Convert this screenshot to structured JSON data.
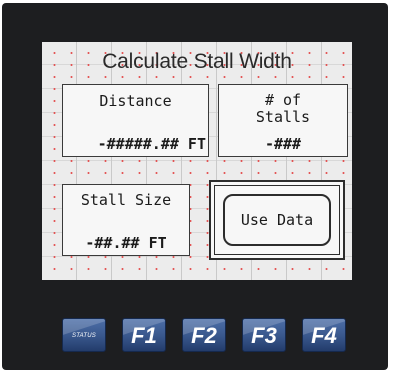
{
  "screen": {
    "title": "Calculate Stall Width",
    "distance": {
      "label": "Distance",
      "value": "-#####.## FT"
    },
    "stalls": {
      "label_line1": "# of",
      "label_line2": "Stalls",
      "value": "-###"
    },
    "stall_size": {
      "label": "Stall Size",
      "value": "-##.## FT"
    },
    "use_data_button": "Use Data"
  },
  "function_keys": [
    {
      "label": "STATUS",
      "icon": "status-key"
    },
    {
      "label": "F1"
    },
    {
      "label": "F2"
    },
    {
      "label": "F3"
    },
    {
      "label": "F4"
    }
  ],
  "colors": {
    "bezel": "#1d1e20",
    "screen": "#ececec",
    "key_blue": "#38568b",
    "grid_dot": "#e23b3b"
  }
}
